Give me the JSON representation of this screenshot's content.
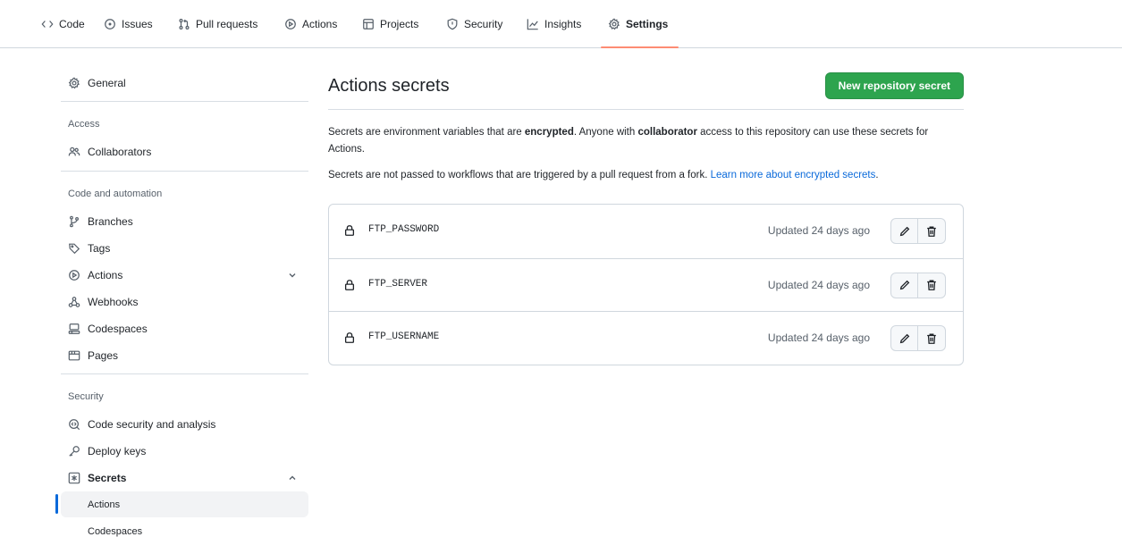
{
  "topnav": {
    "tabs": [
      {
        "label": "Code",
        "icon": "code-icon"
      },
      {
        "label": "Issues",
        "icon": "issue-icon"
      },
      {
        "label": "Pull requests",
        "icon": "pull-request-icon"
      },
      {
        "label": "Actions",
        "icon": "play-icon"
      },
      {
        "label": "Projects",
        "icon": "table-icon"
      },
      {
        "label": "Security",
        "icon": "shield-icon"
      },
      {
        "label": "Insights",
        "icon": "graph-icon"
      },
      {
        "label": "Settings",
        "icon": "gear-icon",
        "active": true
      }
    ],
    "active_color": "#fd8c73"
  },
  "sidebar": {
    "general": "General",
    "access_heading": "Access",
    "collaborators": "Collaborators",
    "code_automation_heading": "Code and automation",
    "branches": "Branches",
    "tags": "Tags",
    "actions": "Actions",
    "webhooks": "Webhooks",
    "codespaces": "Codespaces",
    "pages": "Pages",
    "security_heading": "Security",
    "code_security": "Code security and analysis",
    "deploy_keys": "Deploy keys",
    "secrets": "Secrets",
    "secrets_sub": {
      "actions": "Actions",
      "codespaces": "Codespaces"
    },
    "selected_color": "#0969da"
  },
  "main": {
    "title": "Actions secrets",
    "new_button": "New repository secret",
    "desc1_a": "Secrets are environment variables that are ",
    "desc1_b": "encrypted",
    "desc1_c": ". Anyone with ",
    "desc1_d": "collaborator",
    "desc1_e": " access to this repository can use these secrets for Actions.",
    "desc2": "Secrets are not passed to workflows that are triggered by a pull request from a fork. ",
    "desc2_link": "Learn more about encrypted secrets",
    "desc2_end": ".",
    "secrets": [
      {
        "name": "FTP_PASSWORD",
        "updated": "Updated 24 days ago"
      },
      {
        "name": "FTP_SERVER",
        "updated": "Updated 24 days ago"
      },
      {
        "name": "FTP_USERNAME",
        "updated": "Updated 24 days ago"
      }
    ],
    "button_color": "#2da44e",
    "link_color": "#0969da"
  }
}
